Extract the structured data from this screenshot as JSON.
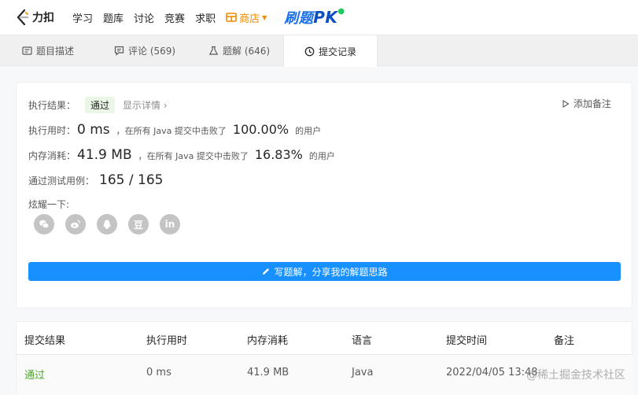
{
  "nav": {
    "logo_text": "力扣",
    "items": [
      "学习",
      "题库",
      "讨论",
      "竞赛",
      "求职"
    ],
    "shop_label": "商店",
    "pk_text": "刷题",
    "pk_suffix": "PK"
  },
  "tabs": [
    {
      "label": "题目描述",
      "icon": "description-icon"
    },
    {
      "label": "评论 (569)",
      "icon": "comment-icon"
    },
    {
      "label": "题解 (646)",
      "icon": "flask-icon"
    },
    {
      "label": "提交记录",
      "icon": "clock-icon",
      "active": true
    }
  ],
  "result": {
    "status_label": "执行结果：",
    "status_value": "通过",
    "detail_link": "显示详情 ›",
    "add_note": "添加备注",
    "runtime_label": "执行用时：",
    "runtime_value": "0 ms",
    "runtime_prefix": "，在所有 Java 提交中击败了",
    "runtime_pct": "100.00%",
    "runtime_suffix": "的用户",
    "memory_label": "内存消耗：",
    "memory_value": "41.9 MB",
    "memory_prefix": "，在所有 Java 提交中击败了",
    "memory_pct": "16.83%",
    "memory_suffix": "的用户",
    "tests_label": "通过测试用例：",
    "tests_value": "165 / 165",
    "share_label": "炫耀一下:",
    "share_icons": [
      "wechat-icon",
      "weibo-icon",
      "qq-icon",
      "douban-icon",
      "linkedin-icon"
    ],
    "douban_glyph": "豆",
    "linkedin_glyph": "in",
    "write_button": "写题解，分享我的解题思路"
  },
  "table": {
    "headers": [
      "提交结果",
      "执行用时",
      "内存消耗",
      "语言",
      "提交时间",
      "备注"
    ],
    "rows": [
      {
        "result": "通过",
        "runtime": "0 ms",
        "memory": "41.9 MB",
        "language": "Java",
        "time": "2022/04/05 13:48",
        "note": ""
      }
    ]
  },
  "watermark": "@稀土掘金技术社区",
  "colors": {
    "accent": "#1890ff",
    "pass_green": "#4ca92a",
    "shop_orange": "#f08a00"
  }
}
